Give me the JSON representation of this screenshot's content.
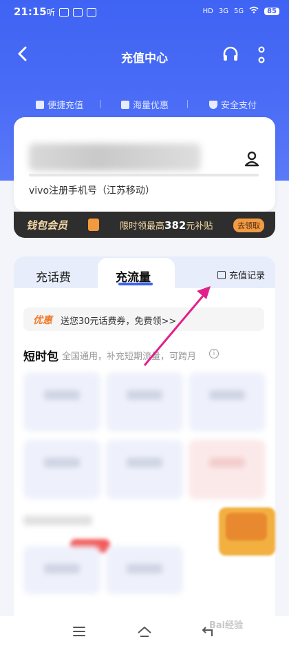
{
  "status_bar": {
    "time": "21:15",
    "left_icons": [
      "听",
      "ai-icon",
      "cloud-icon",
      "app-icon"
    ],
    "signal_labels": [
      "HD",
      "3G",
      "5G"
    ],
    "battery": "85"
  },
  "nav": {
    "title": "充值中心"
  },
  "features": [
    {
      "label": "便捷充值",
      "icon": "phone-icon"
    },
    {
      "label": "海量优惠",
      "icon": "ticket-icon"
    },
    {
      "label": "安全支付",
      "icon": "shield-icon"
    }
  ],
  "phone_card": {
    "number_masked": "",
    "note": "vivo注册手机号（江苏移动）"
  },
  "wallet": {
    "title": "钱包会员",
    "promo_prefix": "限时领最高",
    "promo_amount": "382",
    "promo_suffix": "元补贴",
    "button": "去领取"
  },
  "tabs": {
    "items": [
      "充话费",
      "充流量"
    ],
    "active": "充流量",
    "records_label": "充值记录"
  },
  "coupon": {
    "tag": "优惠",
    "text": "送您30元话费券，免费领>>"
  },
  "section": {
    "title": "短时包",
    "subtitle": "全国通用，补充短期流量，可跨月"
  },
  "watermark": "Bai经验",
  "colors": {
    "primary": "#3f63f3",
    "accent": "#f39a44",
    "arrow": "#e0218a"
  }
}
